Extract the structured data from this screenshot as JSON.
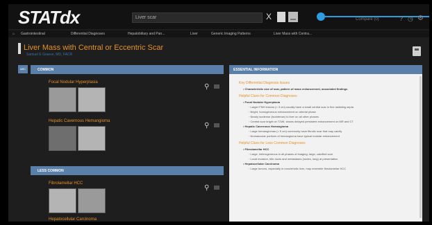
{
  "app": {
    "logo_text": "STATdx",
    "search_value": "Liver scar",
    "clear_symbol": "X",
    "compare_label": "Compare (0)",
    "help_symbol": "?",
    "clock_symbol": "◷",
    "gear_symbol": "⚙",
    "accent_color": "#2d9de0",
    "icons": [
      "close-icon",
      "document-icon",
      "image-icon",
      "pointer-annotation",
      "compare-icon",
      "help-icon",
      "clock-icon",
      "gear-icon",
      "save-icon",
      "zoom-icon",
      "note-icon"
    ]
  },
  "breadcrumbs": [
    "Gastrointestinal",
    "Differential Diagnoses",
    "Hepatobiliary and Pan...",
    "Liver",
    "Generic Imaging Patterns",
    "Liver Mass with Centra..."
  ],
  "page": {
    "title": "Liver Mass with Central or Eccentric Scar",
    "subtitle": "Samuel E Graeve, MD, FACR",
    "title_color": "#e3912c"
  },
  "left_tab_label": "ABC",
  "sections": {
    "common_label": "COMMON",
    "less_common_label": "LESS COMMON"
  },
  "diagnoses": [
    "Focal Nodular Hyperplasia",
    "Hepatic Cavernous Hemangioma",
    "Fibrolamellar HCC",
    "Hepatocellular Carcinoma"
  ],
  "info": {
    "header": "ESSENTIAL INFORMATION",
    "lines": [
      {
        "k": "head",
        "t": "Key Differential Diagnosis Issues"
      },
      {
        "k": "b1",
        "t": "• Characteristic size of scar, pattern of mass enhancement, associated findings"
      },
      {
        "k": "head",
        "t": "Helpful Clues for Common Diagnoses"
      },
      {
        "k": "b1",
        "t": "• Focal Nodular Hyperplasia"
      },
      {
        "k": "b2",
        "t": "◦ Larger FNH lesions (> 3 cm) usually have a small central scar in fine radiating septa"
      },
      {
        "k": "b2",
        "t": "◦ Bright, homogeneous enhancement on arterial phase"
      },
      {
        "k": "b2",
        "t": "◦ Nearly isodense (isointense) to liver on all other phases"
      },
      {
        "k": "b2",
        "t": "◦ Central scar bright on T2WI; shows delayed persistent enhancement on MR and CT"
      },
      {
        "k": "b1",
        "t": "• Hepatic Cavernous Hemangioma"
      },
      {
        "k": "b2",
        "t": "◦ Large hemangiomas (> 5 cm) commonly have fibrotic scar that may calcify"
      },
      {
        "k": "b2",
        "t": "◦ Nonsaccular portions of hemangioma have typical nodular enhancement"
      },
      {
        "k": "head",
        "t": "Helpful Clues for Less Common Diagnoses"
      },
      {
        "k": "b1",
        "t": "• Fibrolamellar HCC"
      },
      {
        "k": "b2",
        "t": "◦ Large, heterogeneous in all phases of imaging; large, calcified scar"
      },
      {
        "k": "b2",
        "t": "◦ Local invasion, bile ducts and metastases (nodes, lung) at presentation"
      },
      {
        "k": "b1",
        "t": "• Hepatocellular Carcinoma"
      },
      {
        "k": "b2",
        "t": "◦ Large tumors, especially in noncirrhotic liver, may resemble fibrolamellar HCC"
      }
    ]
  }
}
